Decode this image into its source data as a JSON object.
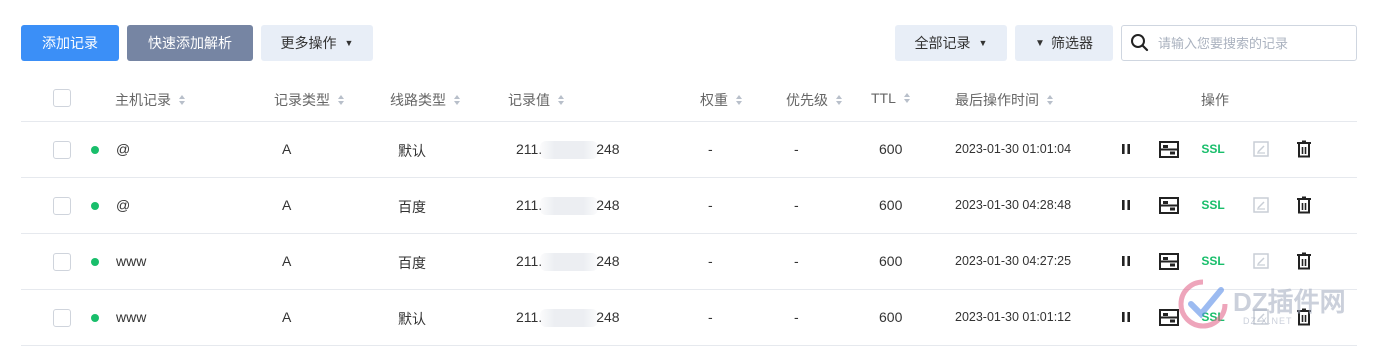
{
  "toolbar": {
    "add_label": "添加记录",
    "quick_label": "快速添加解析",
    "more_label": "更多操作",
    "all_records_label": "全部记录",
    "filter_label": "筛选器",
    "search_placeholder": "请输入您要搜索的记录"
  },
  "table": {
    "headers": {
      "host": "主机记录",
      "type": "记录类型",
      "line": "线路类型",
      "value": "记录值",
      "weight": "权重",
      "priority": "优先级",
      "ttl": "TTL",
      "last_time": "最后操作时间",
      "actions": "操作"
    },
    "rows": [
      {
        "host": "@",
        "type": "A",
        "line": "默认",
        "value_prefix": "211.",
        "value_suffix": "248",
        "weight": "-",
        "priority": "-",
        "ttl": "600",
        "time": "2023-01-30 01:01:04",
        "status_color": "#19be6b"
      },
      {
        "host": "@",
        "type": "A",
        "line": "百度",
        "value_prefix": "211.",
        "value_suffix": "248",
        "weight": "-",
        "priority": "-",
        "ttl": "600",
        "time": "2023-01-30 04:28:48",
        "status_color": "#19be6b"
      },
      {
        "host": "www",
        "type": "A",
        "line": "百度",
        "value_prefix": "211.",
        "value_suffix": "248",
        "weight": "-",
        "priority": "-",
        "ttl": "600",
        "time": "2023-01-30 04:27:25",
        "status_color": "#19be6b"
      },
      {
        "host": "www",
        "type": "A",
        "line": "默认",
        "value_prefix": "211.",
        "value_suffix": "248",
        "weight": "-",
        "priority": "-",
        "ttl": "600",
        "time": "2023-01-30 01:01:12",
        "status_color": "#19be6b"
      }
    ],
    "ssl_label": "SSL"
  },
  "watermark": {
    "text": "DZ插件网",
    "sub": "DZ-X.NET"
  },
  "colors": {
    "primary": "#3b8ff7",
    "secondary": "#7685a3",
    "success": "#19be6b"
  }
}
